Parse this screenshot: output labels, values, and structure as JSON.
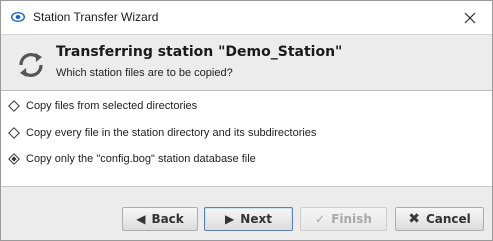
{
  "window": {
    "title": "Station Transfer Wizard",
    "close_label": "✕"
  },
  "header": {
    "title": "Transferring station \"Demo_Station\"",
    "subtitle": "Which station files are to be copied?"
  },
  "options": [
    {
      "label": "Copy files from selected directories",
      "selected": false
    },
    {
      "label": "Copy every file in the station directory and its subdirectories",
      "selected": false
    },
    {
      "label": "Copy only the \"config.bog\" station database file",
      "selected": true
    }
  ],
  "buttons": {
    "back": {
      "label": "Back",
      "enabled": true
    },
    "next": {
      "label": "Next",
      "enabled": true
    },
    "finish": {
      "label": "Finish",
      "enabled": false
    },
    "cancel": {
      "label": "Cancel",
      "enabled": true
    }
  },
  "colors": {
    "accent_blue": "#1565c0",
    "cancel_x": "#3a3a3a",
    "header_bg": "#ececec"
  }
}
